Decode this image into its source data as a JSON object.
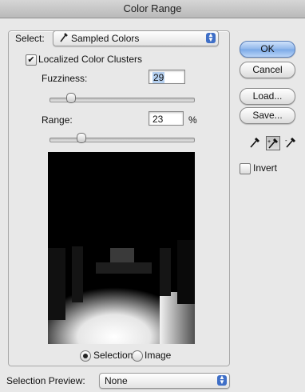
{
  "window": {
    "title": "Color Range"
  },
  "select": {
    "label": "Select:",
    "value": "Sampled Colors"
  },
  "localized": {
    "label": "Localized Color Clusters",
    "checked": true
  },
  "fuzziness": {
    "label": "Fuzziness:",
    "value": "29"
  },
  "range": {
    "label": "Range:",
    "value": "23",
    "unit": "%"
  },
  "view": {
    "options": [
      "Selection",
      "Image"
    ],
    "selected": "Selection"
  },
  "buttons": {
    "ok": "OK",
    "cancel": "Cancel",
    "load": "Load...",
    "save": "Save..."
  },
  "invert": {
    "label": "Invert",
    "checked": false
  },
  "preview_mode": {
    "label": "Selection Preview:",
    "value": "None"
  },
  "colors": {
    "accent": "#3f6fc7",
    "dialog_bg": "#e8e8e8"
  }
}
